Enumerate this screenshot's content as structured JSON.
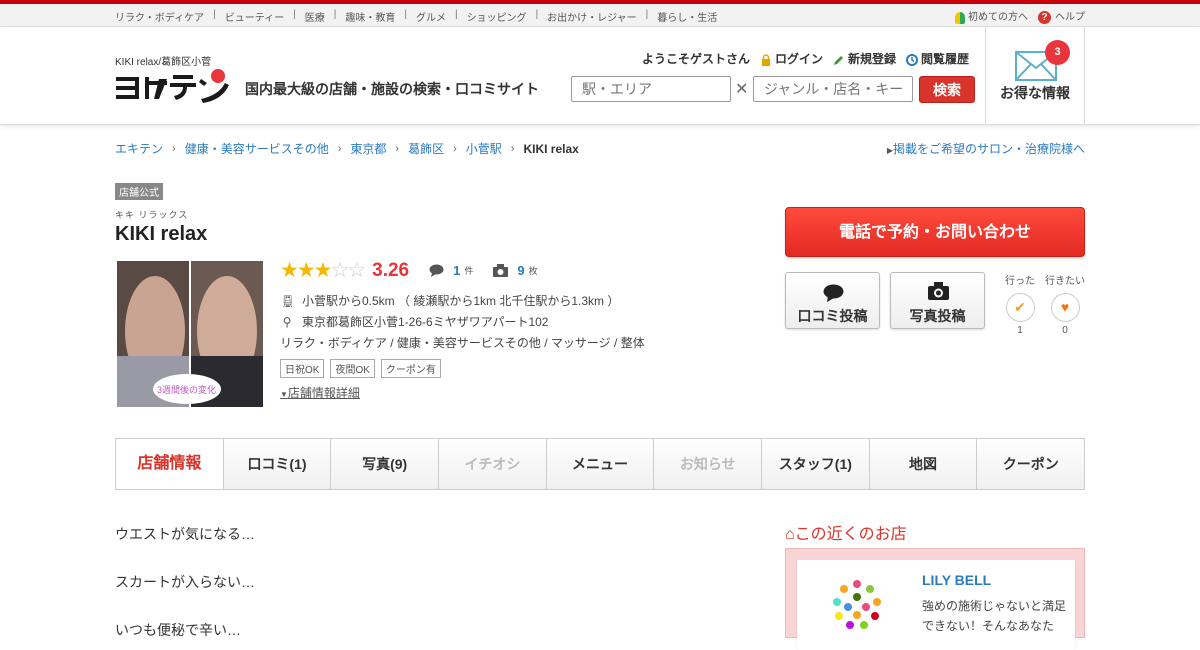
{
  "topnav": {
    "categories": [
      "リラク・ボディケア",
      "ビューティー",
      "医療",
      "趣味・教育",
      "グルメ",
      "ショッピング",
      "お出かけ・レジャー",
      "暮らし・生活"
    ],
    "first_time": "初めての方へ",
    "help": "ヘルプ"
  },
  "header": {
    "sub": "KIKI relax/葛飾区小菅",
    "tagline": "国内最大級の店舗・施設の検索・口コミサイト",
    "welcome": "ようこそゲストさん",
    "login": "ログイン",
    "register": "新規登録",
    "history": "閲覧履歴",
    "area_placeholder": "駅・エリア",
    "genre_placeholder": "ジャンル・店名・キーワード",
    "search_label": "検索",
    "deals_label": "お得な情報",
    "deals_count": "3"
  },
  "breadcrumb": [
    "エキテン",
    "健康・美容サービスその他",
    "東京都",
    "葛飾区",
    "小菅駅",
    "KIKI relax"
  ],
  "promo_link": "掲載をご希望のサロン・治療院様へ",
  "shop": {
    "badge": "店舗公式",
    "kana": "キキ リラックス",
    "name": "KIKI relax",
    "photo_caption": "3週間後の変化",
    "rating": 3.26,
    "rating_text": "3.26",
    "reviews": "1",
    "reviews_unit": "件",
    "photos": "9",
    "photos_unit": "枚",
    "access": "小菅駅から0.5km （ 綾瀬駅から1km 北千住駅から1.3km ）",
    "address": "東京都葛飾区小菅1-26-6ミヤザワアパート102",
    "genres": "リラク・ボディケア / 健康・美容サービスその他  / マッサージ  / 整体",
    "tags": [
      "日祝OK",
      "夜間OK",
      "クーポン有"
    ],
    "detail_link": "店舗情報詳細"
  },
  "actions": {
    "call": "電話で予約・お問い合わせ",
    "review_post": "口コミ投稿",
    "photo_post": "写真投稿",
    "went_label": "行った",
    "went_count": "1",
    "want_label": "行きたい",
    "want_count": "0"
  },
  "tabs": [
    {
      "label": "店舗情報"
    },
    {
      "label": "口コミ(1)"
    },
    {
      "label": "写真(9)"
    },
    {
      "label": "イチオシ"
    },
    {
      "label": "メニュー"
    },
    {
      "label": "お知らせ"
    },
    {
      "label": "スタッフ(1)"
    },
    {
      "label": "地図"
    },
    {
      "label": "クーポン"
    }
  ],
  "description": [
    "ウエストが気になる…",
    "スカートが入らない…",
    "いつも便秘で辛い…"
  ],
  "nearby": {
    "title": "この近くのお店",
    "name": "LILY BELL",
    "text": "強めの施術じゃないと満足できない！そんなあなた"
  },
  "colors": {
    "brand_red": "#d9342b",
    "link_blue": "#2a7bbf",
    "star": "#f5b800"
  }
}
